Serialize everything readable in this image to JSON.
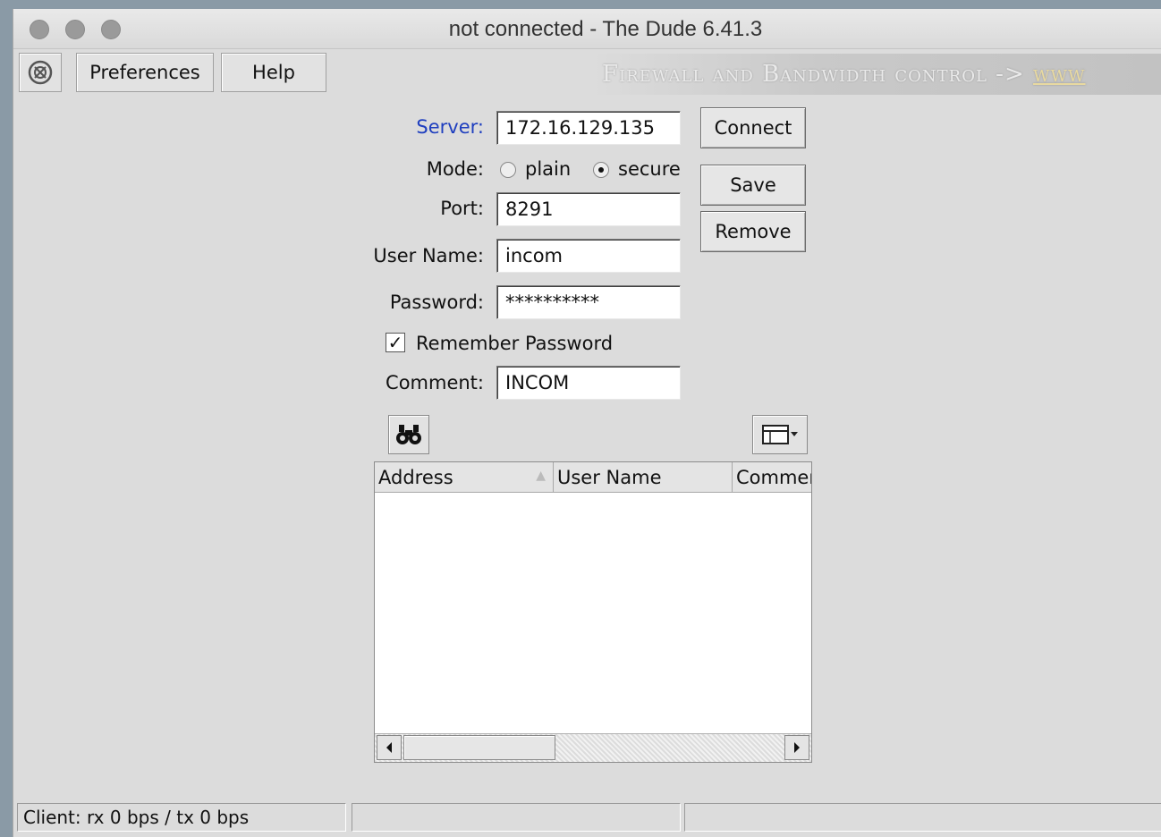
{
  "window": {
    "title": "not connected - The Dude 6.41.3"
  },
  "toolbar": {
    "preferences_label": "Preferences",
    "help_label": "Help",
    "banner_text": "Firewall and Bandwidth control -> ",
    "banner_link": "www"
  },
  "form": {
    "server_label": "Server:",
    "server_value": "172.16.129.135",
    "mode_label": "Mode:",
    "mode_plain": "plain",
    "mode_secure": "secure",
    "mode_selected": "secure",
    "port_label": "Port:",
    "port_value": "8291",
    "username_label": "User Name:",
    "username_value": "incom",
    "password_label": "Password:",
    "password_value": "**********",
    "remember_label": "Remember Password",
    "remember_checked": true,
    "comment_label": "Comment:",
    "comment_value": "INCOM"
  },
  "actions": {
    "connect_label": "Connect",
    "save_label": "Save",
    "remove_label": "Remove"
  },
  "table": {
    "columns": [
      "Address",
      "User Name",
      "Commen"
    ],
    "rows": []
  },
  "status": {
    "client": "Client: rx 0 bps / tx 0 bps",
    "cell2": "",
    "cell3": ""
  },
  "colors": {
    "server_label": "#1f3fbf",
    "window_bg": "#dcdcdc"
  },
  "icons": [
    "dude-logo-icon",
    "binoculars-icon",
    "columns-menu-icon",
    "scroll-left-icon",
    "scroll-right-icon",
    "sort-asc-icon"
  ]
}
